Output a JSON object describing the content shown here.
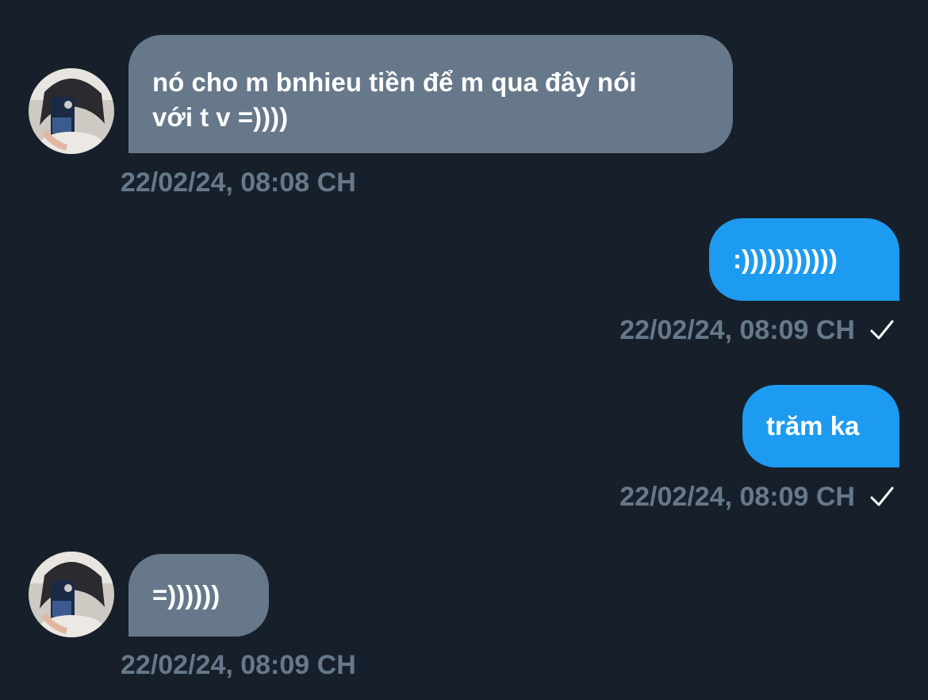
{
  "messages": [
    {
      "direction": "received",
      "text": "nó cho m bnhieu tiền để m qua đây nói\nvới t v =))))",
      "timestamp": "22/02/24, 08:08 CH"
    },
    {
      "direction": "sent",
      "text": ":)))))))))))",
      "timestamp": "22/02/24, 08:09 CH",
      "status_icon": "checkmark-icon"
    },
    {
      "direction": "sent",
      "text": "trăm ka",
      "timestamp": "22/02/24, 08:09 CH",
      "status_icon": "checkmark-icon"
    },
    {
      "direction": "received",
      "text": "=))))))",
      "timestamp": "22/02/24, 08:09 CH"
    }
  ],
  "colors": {
    "background": "#17202a",
    "received_bubble": "#66788a",
    "sent_bubble": "#1d9bf0",
    "timestamp": "#66788a",
    "text": "#ffffff"
  }
}
